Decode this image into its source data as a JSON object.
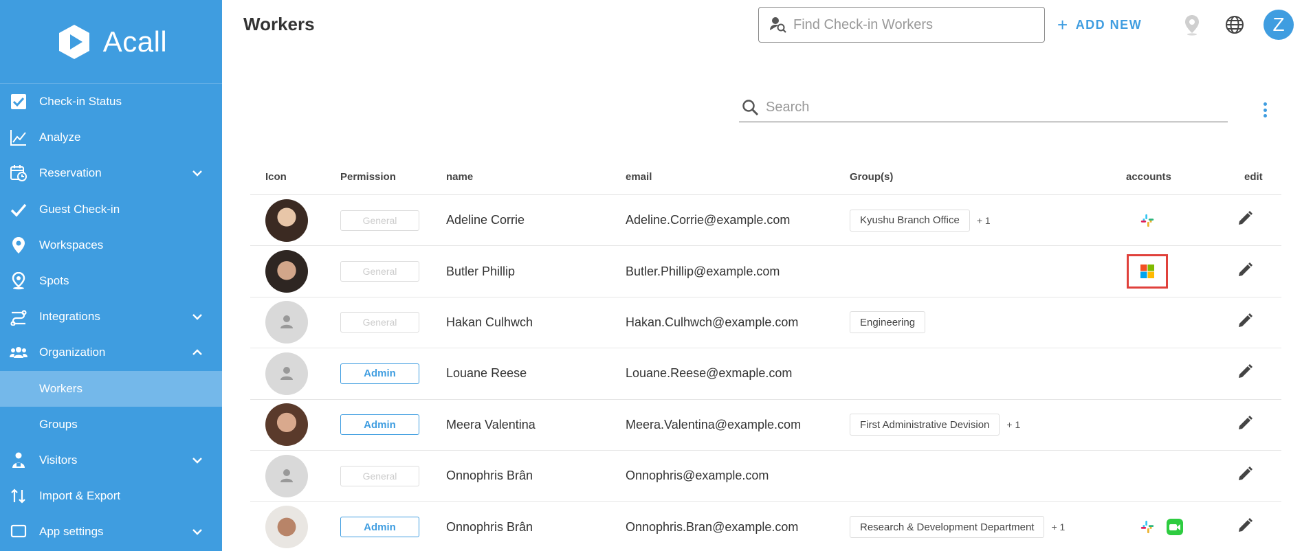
{
  "app": {
    "name": "Acall"
  },
  "sidebar": {
    "items": [
      {
        "label": "Check-in Status",
        "icon": "checkbox-icon"
      },
      {
        "label": "Analyze",
        "icon": "line-chart-icon"
      },
      {
        "label": "Reservation",
        "icon": "calendar-clock-icon",
        "expandable": true,
        "expanded": false
      },
      {
        "label": "Guest Check-in",
        "icon": "checkmark-icon"
      },
      {
        "label": "Workspaces",
        "icon": "location-pin-icon"
      },
      {
        "label": "Spots",
        "icon": "spot-pin-icon"
      },
      {
        "label": "Integrations",
        "icon": "integration-icon",
        "expandable": true,
        "expanded": false
      },
      {
        "label": "Organization",
        "icon": "people-group-icon",
        "expandable": true,
        "expanded": true
      },
      {
        "label": "Workers",
        "sub": true,
        "active": true
      },
      {
        "label": "Groups",
        "sub": true
      },
      {
        "label": "Visitors",
        "icon": "visitor-icon",
        "expandable": true,
        "expanded": false
      },
      {
        "label": "Import & Export",
        "icon": "import-export-icon"
      },
      {
        "label": "App settings",
        "icon": "app-settings-icon",
        "expandable": true,
        "expanded": false
      }
    ]
  },
  "header": {
    "title": "Workers",
    "find_placeholder": "Find Check-in Workers",
    "add_new_label": "ADD NEW",
    "user_initial": "Z"
  },
  "search": {
    "placeholder": "Search"
  },
  "table": {
    "columns": [
      "Icon",
      "Permission",
      "name",
      "email",
      "Group(s)",
      "accounts",
      "edit"
    ],
    "rows": [
      {
        "avatar": "photo1",
        "permission": "General",
        "name": "Adeline Corrie",
        "email": "Adeline.Corrie@example.com",
        "group": "Kyushu Branch Office",
        "more": "+ 1",
        "accounts": [
          "slack"
        ]
      },
      {
        "avatar": "photo2",
        "permission": "General",
        "name": "Butler Phillip",
        "email": "Butler.Phillip@example.com",
        "group": "",
        "more": "",
        "accounts": [
          "microsoft-highlighted"
        ]
      },
      {
        "avatar": "placeholder",
        "permission": "General",
        "name": "Hakan Culhwch",
        "email": "Hakan.Culhwch@example.com",
        "group": "Engineering",
        "more": "",
        "accounts": []
      },
      {
        "avatar": "placeholder",
        "permission": "Admin",
        "name": "Louane Reese",
        "email": "Louane.Reese@exmaple.com",
        "group": "",
        "more": "",
        "accounts": []
      },
      {
        "avatar": "photo3",
        "permission": "Admin",
        "name": "Meera Valentina",
        "email": "Meera.Valentina@example.com",
        "group": "First Administrative Devision",
        "more": "+ 1",
        "accounts": []
      },
      {
        "avatar": "placeholder",
        "permission": "General",
        "name": "Onnophris Brân",
        "email": "Onnophris@example.com",
        "group": "",
        "more": "",
        "accounts": []
      },
      {
        "avatar": "photo4",
        "permission": "Admin",
        "name": "Onnophris Brân",
        "email": "Onnophris.Bran@example.com",
        "group": "Research & Development Department",
        "more": "+ 1",
        "accounts": [
          "slack",
          "facetime"
        ]
      }
    ]
  },
  "colors": {
    "accent": "#3f9de0",
    "sidebar_bg": "#3f9de0",
    "highlight": "#e0413b"
  }
}
